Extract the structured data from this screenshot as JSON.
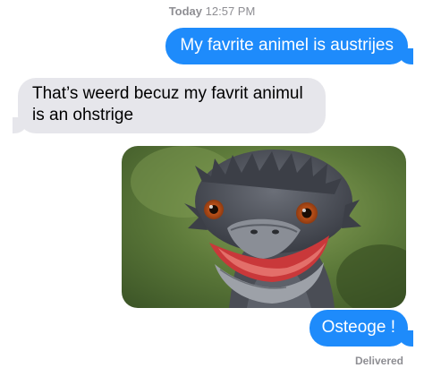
{
  "header": {
    "day": "Today",
    "time": "12:57 PM"
  },
  "messages": [
    {
      "direction": "sent",
      "text": "My favrite animel is austrijes"
    },
    {
      "direction": "received",
      "text": "That’s weerd becuz my favrit animul is an ohstrige"
    },
    {
      "direction": "sent",
      "type": "image",
      "subject": "emu-photo"
    },
    {
      "direction": "sent",
      "text": "Osteoge !"
    }
  ],
  "status": {
    "delivery": "Delivered"
  },
  "colors": {
    "sent_bubble": "#1e8bfb",
    "received_bubble": "#e6e6eb",
    "meta_text": "#8e8e93"
  }
}
